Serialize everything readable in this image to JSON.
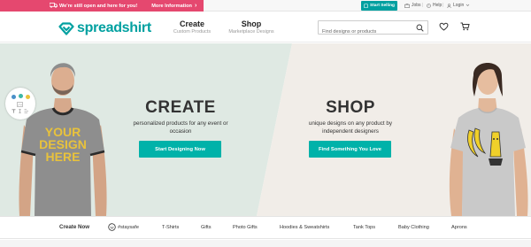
{
  "promo_bar": {
    "message": "We're still open and here for you!",
    "more_info": "More Information",
    "arrow": "›",
    "color": "#e5486f"
  },
  "util_nav": {
    "start_selling": "Start Selling",
    "jobs": "Jobs",
    "help": "Help",
    "login": "Login"
  },
  "header": {
    "logo": "spreadshirt",
    "brand_color": "#00a0a0",
    "nav": [
      {
        "title": "Create",
        "subtitle": "Custom Products"
      },
      {
        "title": "Shop",
        "subtitle": "Marketplace Designs"
      }
    ],
    "search": {
      "placeholder": "Find designs or products",
      "value": ""
    },
    "icons": [
      "search-icon",
      "heart-icon",
      "cart-icon"
    ]
  },
  "hero": {
    "left": {
      "title": "CREATE",
      "subtitle_line1": "personalized products for any event or",
      "subtitle_line2": "occasion",
      "button": "Start Designing Now",
      "shirt_text_1": "YOUR",
      "shirt_text_2": "DESIGN",
      "shirt_text_3": "HERE"
    },
    "right": {
      "title": "SHOP",
      "subtitle_line1": "unique designs on any product by",
      "subtitle_line2": "independent designers",
      "button": "Find Something You Love"
    },
    "button_color": "#00b2a9"
  },
  "categories": {
    "items": [
      "Create Now",
      "#staysafe",
      "T-Shirts",
      "Gifts",
      "Photo Gifts",
      "Hoodies & Sweatshirts",
      "Tank Tops",
      "Baby Clothing",
      "Aprons"
    ]
  }
}
